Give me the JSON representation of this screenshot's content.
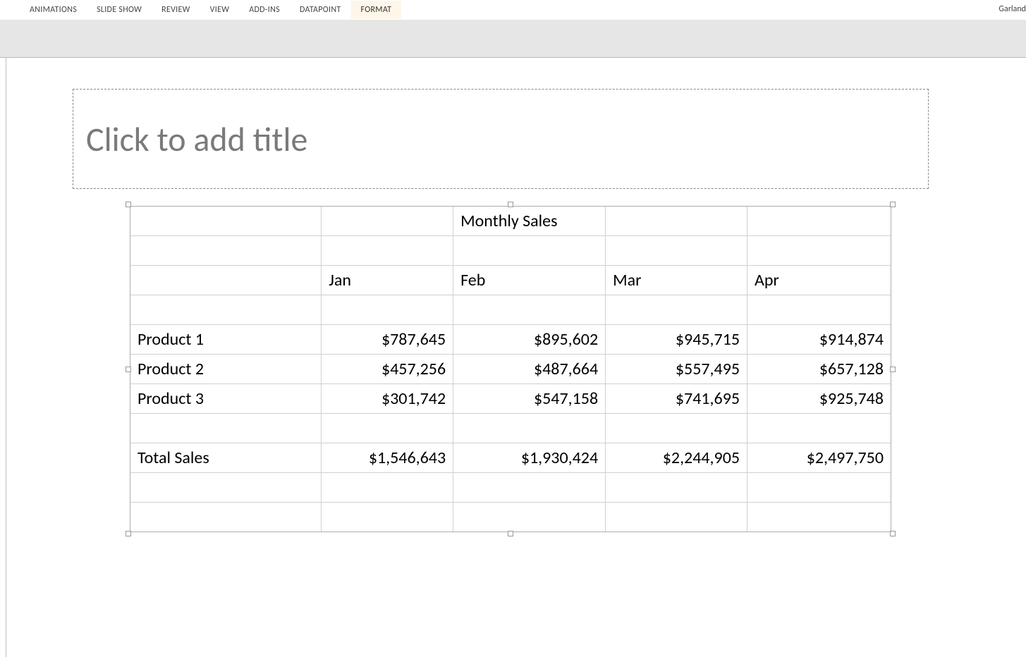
{
  "user": "Garland",
  "tabs": {
    "animations": "ANIMATIONS",
    "slide_show": "SLIDE SHOW",
    "review": "REVIEW",
    "view": "VIEW",
    "add_ins": "ADD-INS",
    "datapoint": "DATAPOINT",
    "format": "FORMAT"
  },
  "title_placeholder": "Click to add title",
  "table": {
    "title": "Monthly Sales",
    "months": {
      "jan": "Jan",
      "feb": "Feb",
      "mar": "Mar",
      "apr": "Apr"
    },
    "rows": {
      "p1": {
        "label": "Product 1",
        "jan": "$787,645",
        "feb": "$895,602",
        "mar": "$945,715",
        "apr": "$914,874"
      },
      "p2": {
        "label": "Product 2",
        "jan": "$457,256",
        "feb": "$487,664",
        "mar": "$557,495",
        "apr": "$657,128"
      },
      "p3": {
        "label": "Product 3",
        "jan": "$301,742",
        "feb": "$547,158",
        "mar": "$741,695",
        "apr": "$925,748"
      },
      "total": {
        "label": "Total Sales",
        "jan": "$1,546,643",
        "feb": "$1,930,424",
        "mar": "$2,244,905",
        "apr": "$2,497,750"
      }
    }
  },
  "chart_data": {
    "type": "table",
    "title": "Monthly Sales",
    "columns": [
      "Jan",
      "Feb",
      "Mar",
      "Apr"
    ],
    "series": [
      {
        "name": "Product 1",
        "values": [
          787645,
          895602,
          945715,
          914874
        ]
      },
      {
        "name": "Product 2",
        "values": [
          457256,
          487664,
          557495,
          657128
        ]
      },
      {
        "name": "Product 3",
        "values": [
          301742,
          547158,
          741695,
          925748
        ]
      },
      {
        "name": "Total Sales",
        "values": [
          1546643,
          1930424,
          2244905,
          2497750
        ]
      }
    ]
  }
}
